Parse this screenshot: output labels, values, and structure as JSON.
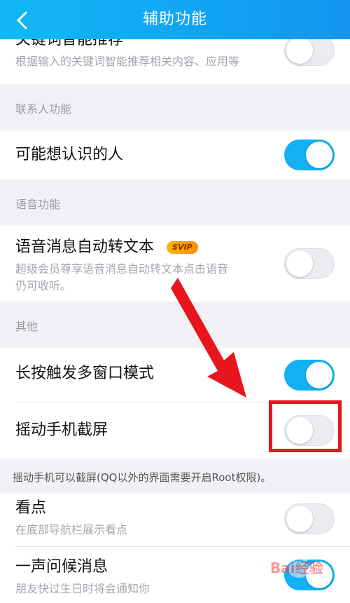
{
  "header": {
    "title": "辅助功能"
  },
  "rows": {
    "keyword": {
      "name": "关键词智能推荐",
      "desc": "根据输入的关键词智能推荐相关内容、应用等",
      "on": false
    },
    "contacts": {
      "name": "可能想认识的人",
      "on": true
    },
    "voice": {
      "name": "语音消息自动转文本",
      "badge": "SVIP",
      "desc": "超级会员尊享语音消息自动转文本点击语音仍可收听。",
      "on": false
    },
    "longpress": {
      "name": "长按触发多窗口模式",
      "on": true
    },
    "shake": {
      "name": "摇动手机截屏",
      "on": false
    },
    "kandian": {
      "name": "看点",
      "desc": "在底部导航栏展示看点",
      "on": false
    },
    "greeting": {
      "name": "一声问候消息",
      "desc": "朋友快过生日时将会通知你",
      "on": true
    }
  },
  "sections": {
    "contacts": "联系人功能",
    "voice": "语音功能",
    "other": "其他"
  },
  "notes": {
    "shake": "摇动手机可以截屏(QQ以外的界面需要开启Root权限)。"
  },
  "watermark": {
    "text": "Bai经验"
  },
  "colors": {
    "accent": "#13b0f3",
    "highlight": "#e8141e"
  }
}
